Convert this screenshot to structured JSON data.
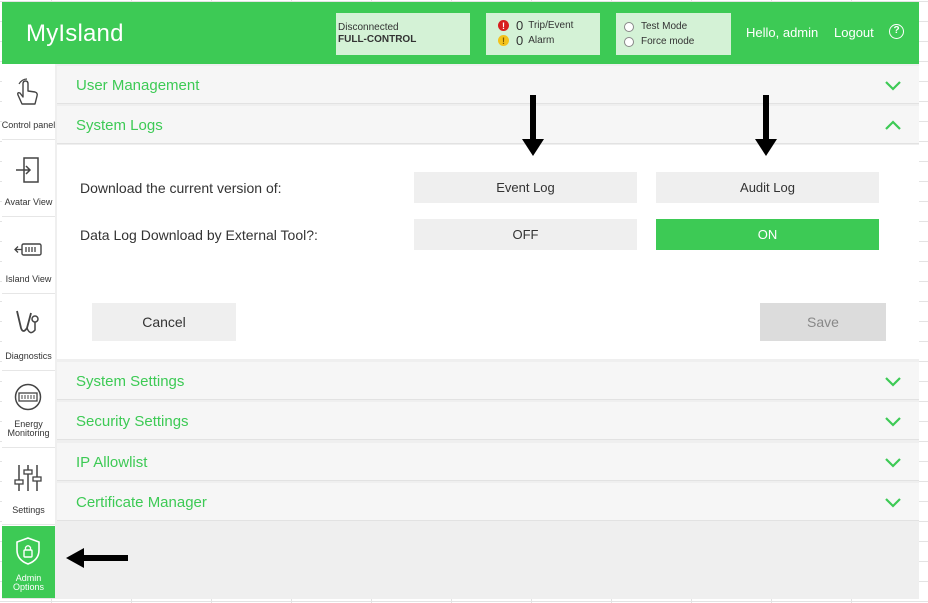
{
  "app": {
    "title": "MyIsland"
  },
  "header": {
    "connection_status": "Disconnected",
    "control_mode": "FULL-CONTROL",
    "trip_count": "0",
    "trip_label": "Trip/Event",
    "alarm_count": "0",
    "alarm_label": "Alarm",
    "test_mode_label": "Test Mode",
    "force_mode_label": "Force mode",
    "greeting": "Hello, admin",
    "logout_label": "Logout",
    "help_glyph": "?"
  },
  "sidebar": {
    "items": [
      {
        "label": "Control panel",
        "icon": "hand-pointer-icon"
      },
      {
        "label": "Avatar View",
        "icon": "login-door-icon"
      },
      {
        "label": "Island View",
        "icon": "battery-plug-icon"
      },
      {
        "label": "Diagnostics",
        "icon": "stethoscope-icon"
      },
      {
        "label": "Energy Monitoring",
        "icon": "meter-icon"
      },
      {
        "label": "Settings",
        "icon": "sliders-icon"
      },
      {
        "label": "Admin Options",
        "icon": "shield-lock-icon",
        "active": true
      }
    ]
  },
  "sections": [
    {
      "title": "User Management",
      "expanded": false
    },
    {
      "title": "System Logs",
      "expanded": true
    },
    {
      "title": "System Settings",
      "expanded": false
    },
    {
      "title": "Security Settings",
      "expanded": false
    },
    {
      "title": "IP Allowlist",
      "expanded": false
    },
    {
      "title": "Certificate Manager",
      "expanded": false
    }
  ],
  "system_logs": {
    "download_label": "Download the current version of:",
    "event_log_button": "Event Log",
    "audit_log_button": "Audit Log",
    "external_tool_label": "Data Log Download by External Tool?:",
    "off_button": "OFF",
    "on_button": "ON",
    "selected": "ON",
    "cancel_button": "Cancel",
    "save_button": "Save"
  },
  "colors": {
    "accent": "#3dca55",
    "status_bg": "#d4f2d6",
    "alert_red": "#d71f1f",
    "alert_yellow": "#f4c21b"
  }
}
